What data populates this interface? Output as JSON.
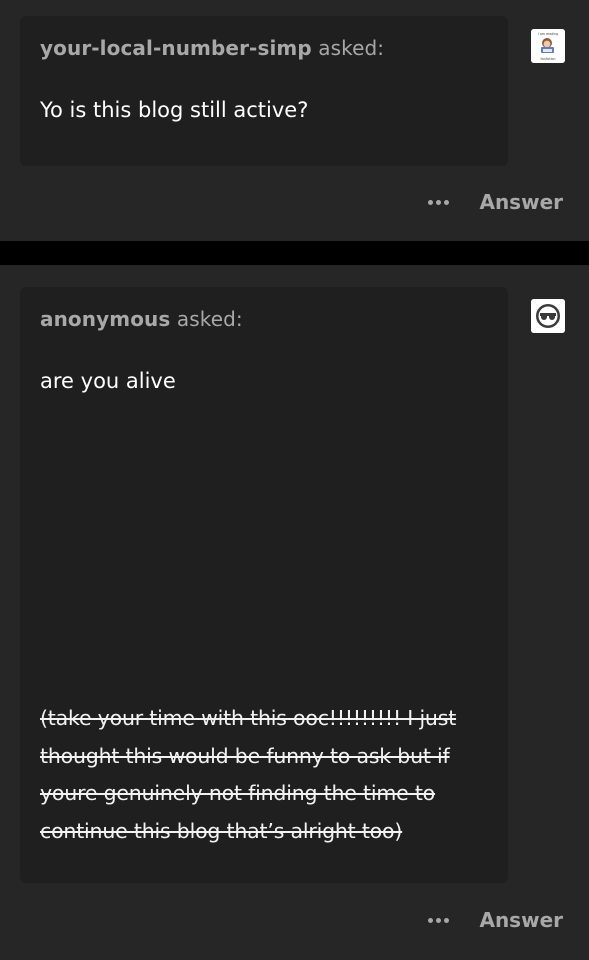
{
  "posts": [
    {
      "asker": "your-local-number-simp",
      "asked_label": "asked:",
      "question": "Yo is this blog still active?",
      "avatar_icon": "reading-fanfiction-sticker-icon",
      "avatar_text": [
        "I am reading",
        "fanfiction"
      ],
      "answer_label": "Answer"
    },
    {
      "asker": "anonymous",
      "asked_label": "asked:",
      "question": "are you alive",
      "note": "(take your time with this ooc!!!!!!!!! I just thought this would be funny to ask but if youre genuinely not finding the time to continue this blog that’s alright too)",
      "avatar_icon": "sunglasses-anon-icon",
      "answer_label": "Answer"
    }
  ],
  "colors": {
    "background": "#000000",
    "card": "#262626",
    "bubble": "#1f1f1f",
    "muted_text": "#a8a8a8",
    "text": "#ffffff"
  }
}
